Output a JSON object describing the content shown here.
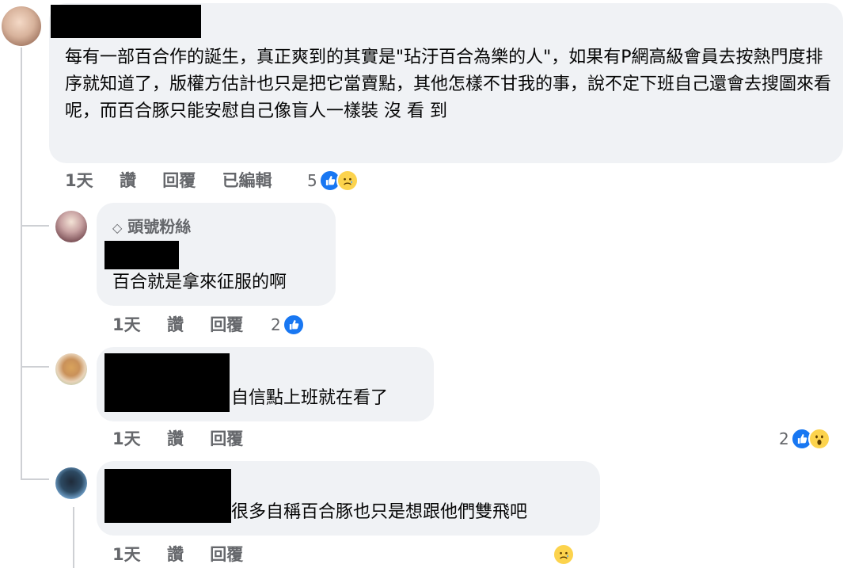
{
  "comments": [
    {
      "text": "每有一部百合作的誕生，真正爽到的其實是\"玷汙百合為樂的人\"，如果有P網高級會員去按熱門度排序就知道了，版權方估計也只是把它當賣點，其他怎樣不甘我的事，說不定下班自己還會去搜圖來看呢，而百合豚只能安慰自己像盲人一樣裝 沒 看 到",
      "time": "1天",
      "like": "讚",
      "reply": "回覆",
      "edited": "已編輯",
      "reaction_count": "5",
      "reactions": [
        "like-icon",
        "sad-icon"
      ]
    }
  ],
  "replies": [
    {
      "badge": "頭號粉絲",
      "text": "百合就是拿來征服的啊",
      "time": "1天",
      "like": "讚",
      "reply": "回覆",
      "reaction_count": "2",
      "reactions": [
        "like-icon"
      ]
    },
    {
      "text": "自信點上班就在看了",
      "time": "1天",
      "like": "讚",
      "reply": "回覆",
      "reaction_count": "2",
      "reactions": [
        "like-icon",
        "wow-icon"
      ]
    },
    {
      "text": "很多自稱百合豚也只是想跟他們雙飛吧",
      "time": "1天",
      "like": "讚",
      "reply": "回覆",
      "reaction_count": "",
      "reactions": [
        "sad-icon"
      ]
    }
  ],
  "colors": {
    "bubble": "#f0f2f5",
    "like": "#1877f2",
    "meta": "#65676b"
  }
}
